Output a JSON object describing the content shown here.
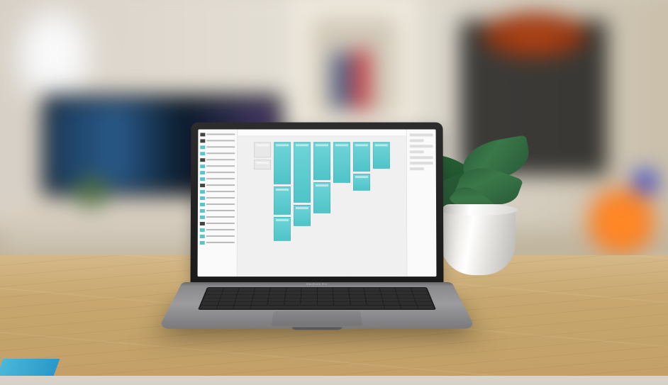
{
  "scene": {
    "description": "Photograph of a MacBook Pro laptop on a light wooden desk in a softly lit home office. A potted orchid plant sits to the right. Background is heavily blurred: a floor lamp, wall-mounted TV on a low media console, white shelving with books, a 3D printer frame with orange filament spool, and a warm ambient light on the right.",
    "laptop": {
      "model_label": "MacBook Pro",
      "screen_app": {
        "type": "UI design tool canvas",
        "layers_panel_side": "left",
        "properties_panel_side": "right",
        "artboard_accent_color": "#5ccccf",
        "canvas_background": "#f0f0f0"
      }
    },
    "desk_material": "light oak wood",
    "plant_pot_color": "#eeeeee",
    "ambient_light_color": "#ff8a2a"
  }
}
